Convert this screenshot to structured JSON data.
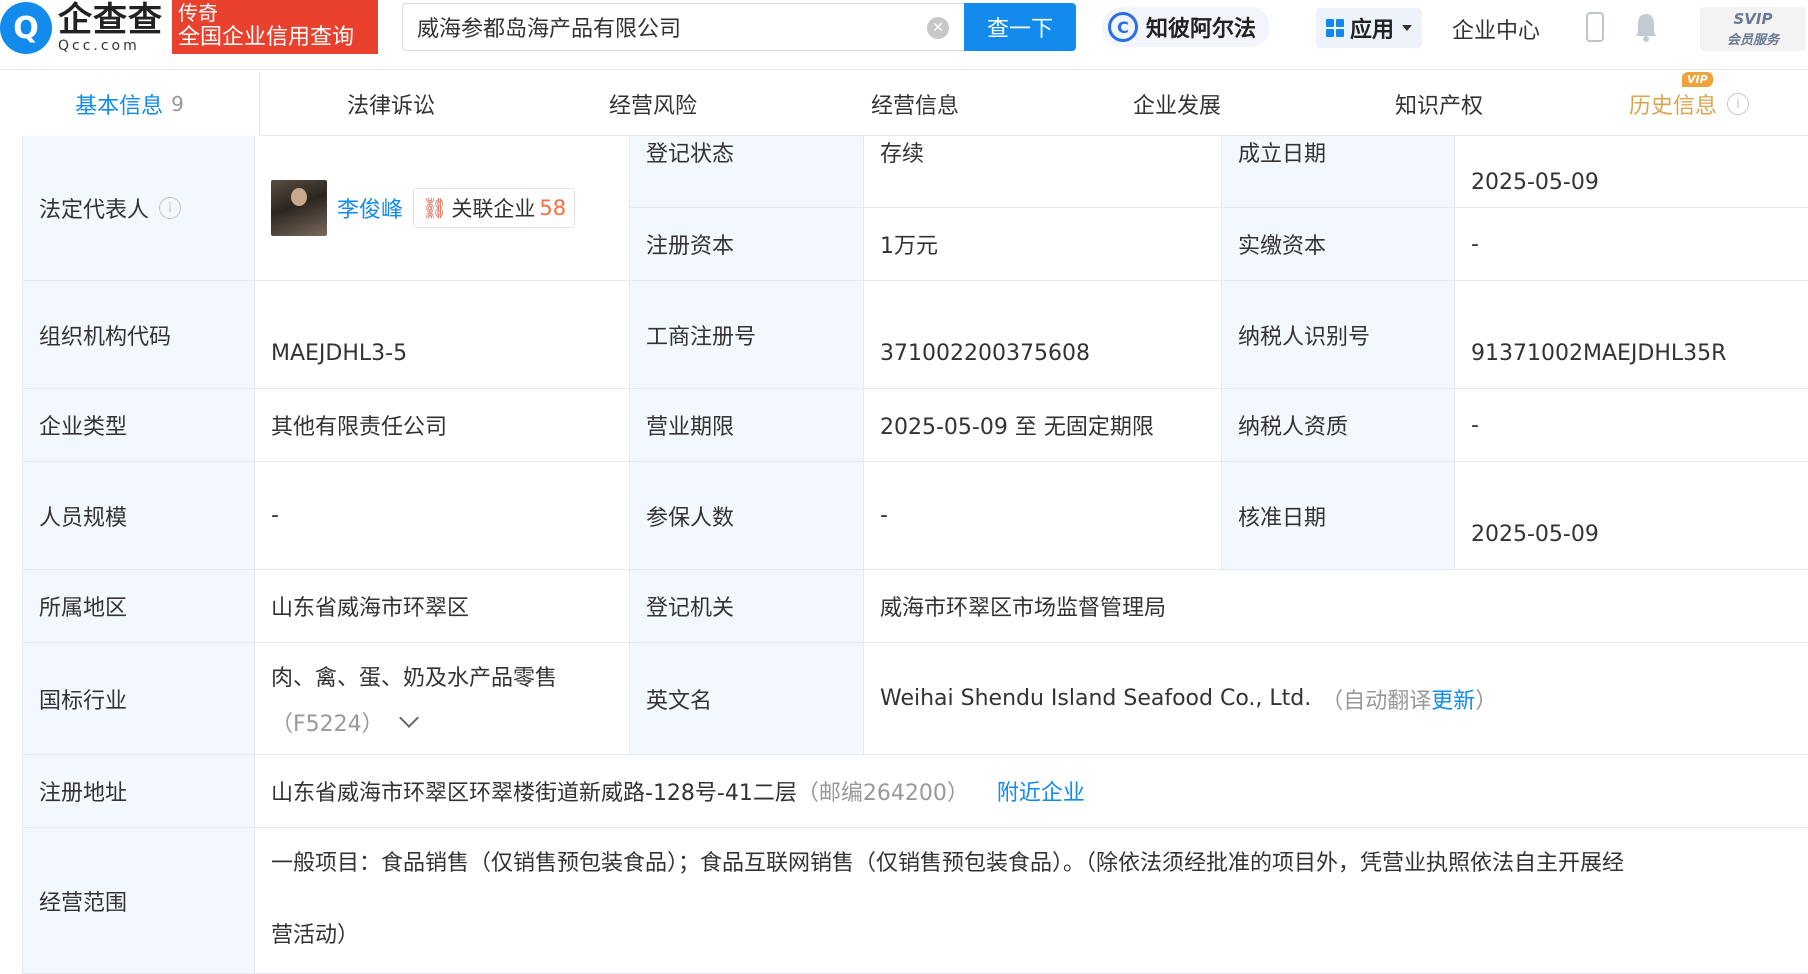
{
  "header": {
    "logo_cn": "企查查",
    "logo_en": "Qcc.com",
    "slogan_line1": "传奇",
    "slogan_line2": "全国企业信用查询",
    "search_value": "威海参都岛海产品有限公司",
    "search_button": "查一下",
    "zhibi_label": "知彼阿尔法",
    "zhibi_icon_letter": "C",
    "apps_label": "应用",
    "enterprise_center": "企业中心",
    "svip_line1": "SVIP",
    "svip_line2": "会员服务"
  },
  "tabs": [
    {
      "label": "基本信息",
      "count": "9"
    },
    {
      "label": "法律诉讼"
    },
    {
      "label": "经营风险"
    },
    {
      "label": "经营信息"
    },
    {
      "label": "企业发展"
    },
    {
      "label": "知识产权"
    },
    {
      "label": "历史信息",
      "badge": "VIP"
    }
  ],
  "info": {
    "legal_rep_label": "法定代表人",
    "legal_rep_name": "李俊峰",
    "related_label": "关联企业",
    "related_count": "58",
    "reg_status_label": "登记状态",
    "reg_status": "存续",
    "found_date_label": "成立日期",
    "found_date": "2025-05-09",
    "reg_capital_label": "注册资本",
    "reg_capital": "1万元",
    "paid_capital_label": "实缴资本",
    "paid_capital": "-",
    "org_code_label": "组织机构代码",
    "org_code": "MAEJDHL3-5",
    "biz_reg_no_label": "工商注册号",
    "biz_reg_no": "371002200375608",
    "taxpayer_id_label": "纳税人识别号",
    "taxpayer_id": "91371002MAEJDHL35R",
    "company_type_label": "企业类型",
    "company_type": "其他有限责任公司",
    "biz_term_label": "营业期限",
    "biz_term": "2025-05-09 至 无固定期限",
    "taxpayer_qual_label": "纳税人资质",
    "taxpayer_qual": "-",
    "staff_size_label": "人员规模",
    "staff_size": "-",
    "insured_label": "参保人数",
    "insured": "-",
    "approval_date_label": "核准日期",
    "approval_date": "2025-05-09",
    "region_label": "所属地区",
    "region": "山东省威海市环翠区",
    "reg_authority_label": "登记机关",
    "reg_authority": "威海市环翠区市场监督管理局",
    "industry_label": "国标行业",
    "industry_line1": "肉、禽、蛋、奶及水产品零售",
    "industry_code": "（F5224）",
    "english_name_label": "英文名",
    "english_name": "Weihai Shendu Island Seafood Co., Ltd.",
    "english_note_open": "（自动翻译",
    "english_update": "更新",
    "english_note_close": "）",
    "address_label": "注册地址",
    "address": "山东省威海市环翠区环翠楼街道新威路-128号-41二层",
    "postcode": "（邮编264200）",
    "nearby": "附近企业",
    "scope_label": "经营范围",
    "scope_line1": "一般项目：食品销售（仅销售预包装食品）；食品互联网销售（仅销售预包装食品）。（除依法须经批准的项目外，凭营业执照依法自主开展经",
    "scope_line2": "营活动）"
  }
}
